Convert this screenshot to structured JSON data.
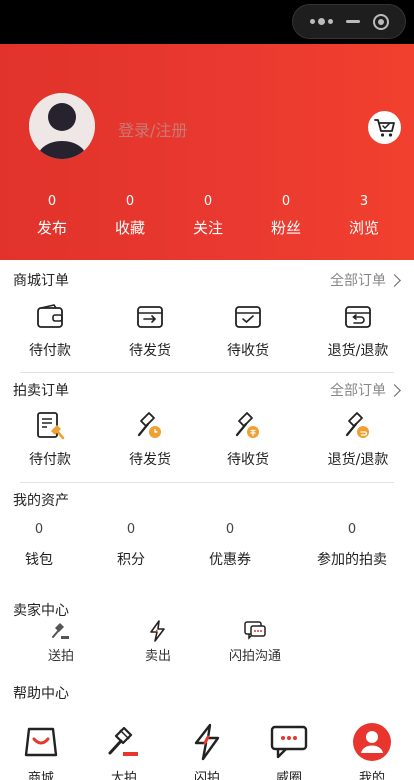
{
  "profile": {
    "login_text": "登录/注册",
    "stats": [
      {
        "value": "0",
        "label": "发布"
      },
      {
        "value": "0",
        "label": "收藏"
      },
      {
        "value": "0",
        "label": "关注"
      },
      {
        "value": "0",
        "label": "粉丝"
      },
      {
        "value": "3",
        "label": "浏览"
      }
    ]
  },
  "mall_orders": {
    "title": "商城订单",
    "all_link": "全部订单",
    "items": [
      {
        "label": "待付款",
        "icon": "wallet-icon"
      },
      {
        "label": "待发货",
        "icon": "box-out-icon"
      },
      {
        "label": "待收货",
        "icon": "box-check-icon"
      },
      {
        "label": "退货/退款",
        "icon": "box-return-icon"
      }
    ]
  },
  "auction_orders": {
    "title": "拍卖订单",
    "all_link": "全部订单",
    "items": [
      {
        "label": "待付款",
        "icon": "bill-gavel-icon"
      },
      {
        "label": "待发货",
        "icon": "gavel-clock-icon"
      },
      {
        "label": "待收货",
        "icon": "gavel-coin-icon"
      },
      {
        "label": "退货/退款",
        "icon": "gavel-return-icon"
      }
    ]
  },
  "assets": {
    "title": "我的资产",
    "items": [
      {
        "value": "0",
        "label": "钱包"
      },
      {
        "value": "0",
        "label": "积分"
      },
      {
        "value": "0",
        "label": "优惠券"
      },
      {
        "value": "0",
        "label": "参加的拍卖"
      }
    ]
  },
  "seller_center": {
    "title": "卖家中心",
    "items": [
      {
        "label": "送拍",
        "icon": "gavel-icon"
      },
      {
        "label": "卖出",
        "icon": "lightning-icon"
      },
      {
        "label": "闪拍沟通",
        "icon": "chat-icon"
      }
    ]
  },
  "help_center": {
    "title": "帮助中心"
  },
  "tabbar": {
    "items": [
      {
        "label": "商城",
        "icon": "shopping-bag-icon"
      },
      {
        "label": "大拍",
        "icon": "gavel-icon"
      },
      {
        "label": "闪拍",
        "icon": "lightning-icon"
      },
      {
        "label": "威圈",
        "icon": "chat-bubble-icon"
      },
      {
        "label": "我的",
        "icon": "user-icon",
        "active": true
      }
    ]
  },
  "colors": {
    "brand_red": "#e8352d",
    "accent_orange": "#f0a030",
    "muted_text": "#888888"
  }
}
